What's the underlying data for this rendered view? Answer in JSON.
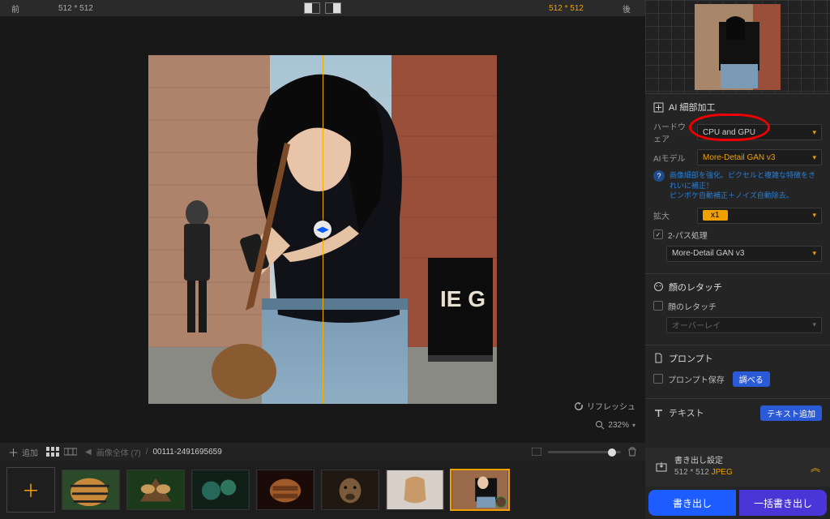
{
  "topbar": {
    "before": "前",
    "after": "後",
    "dim_left": "512 * 512",
    "dim_right": "512 * 512"
  },
  "viewport": {
    "refresh": "リフレッシュ",
    "zoom": "232%"
  },
  "filmbar": {
    "add": "追加",
    "crumb": "画像全体 (7)",
    "filename": "00111-2491695659"
  },
  "panel_ai": {
    "title": "AI 細部加工",
    "hardware_label": "ハードウェア",
    "hardware_value": "CPU and GPU",
    "model_label": "AIモデル",
    "model_value": "More-Detail GAN v3",
    "desc1": "画像細部を強化。ピクセルと複雑な特徴をきれいに補正！",
    "desc2": "ピンボケ自動補正＋ノイズ自動除去。",
    "enlarge_label": "拡大",
    "enlarge_value": "x1",
    "twopass": "2-パス処理",
    "twopass_model": "More-Detail GAN v3"
  },
  "panel_face": {
    "title": "顔のレタッチ",
    "checkbox": "顔のレタッチ",
    "overlay": "オーバーレイ"
  },
  "panel_prompt": {
    "title": "プロンプト",
    "save": "プロンプト保存",
    "adjust": "調べる"
  },
  "panel_text": {
    "title": "テキスト",
    "add": "テキスト追加"
  },
  "export": {
    "title": "書き出し設定",
    "dims": "512 * 512",
    "format": "JPEG",
    "export_btn": "書き出し",
    "batch_btn": "一括書き出し"
  }
}
